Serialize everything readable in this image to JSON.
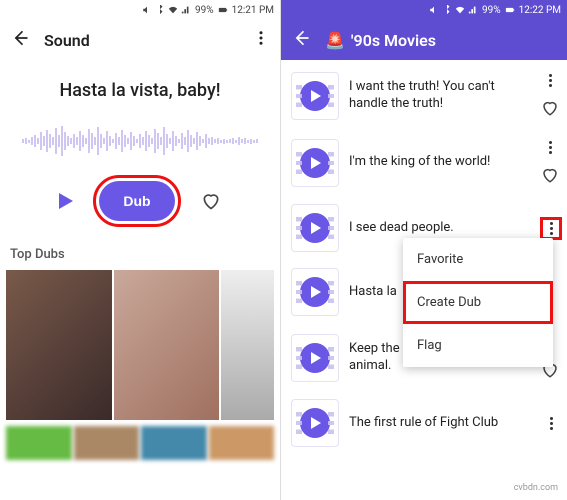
{
  "status": {
    "battery": "99%",
    "time_left": "12:21 PM",
    "time_right": "12:22 PM"
  },
  "left": {
    "appbar_title": "Sound",
    "sound_title": "Hasta la vista, baby!",
    "dub_button": "Dub",
    "section": "Top Dubs"
  },
  "right": {
    "appbar_title": "'90s Movies",
    "appbar_emoji": "🚨",
    "items": [
      "I want the truth! You can't handle the truth!",
      "I'm the king of the world!",
      "I see dead people.",
      "Hasta la",
      "Keep the change, ya filthy animal.",
      "The first rule of Fight Club"
    ],
    "menu": {
      "favorite": "Favorite",
      "create_dub": "Create Dub",
      "flag": "Flag"
    }
  },
  "watermark": "cvbdn.com"
}
